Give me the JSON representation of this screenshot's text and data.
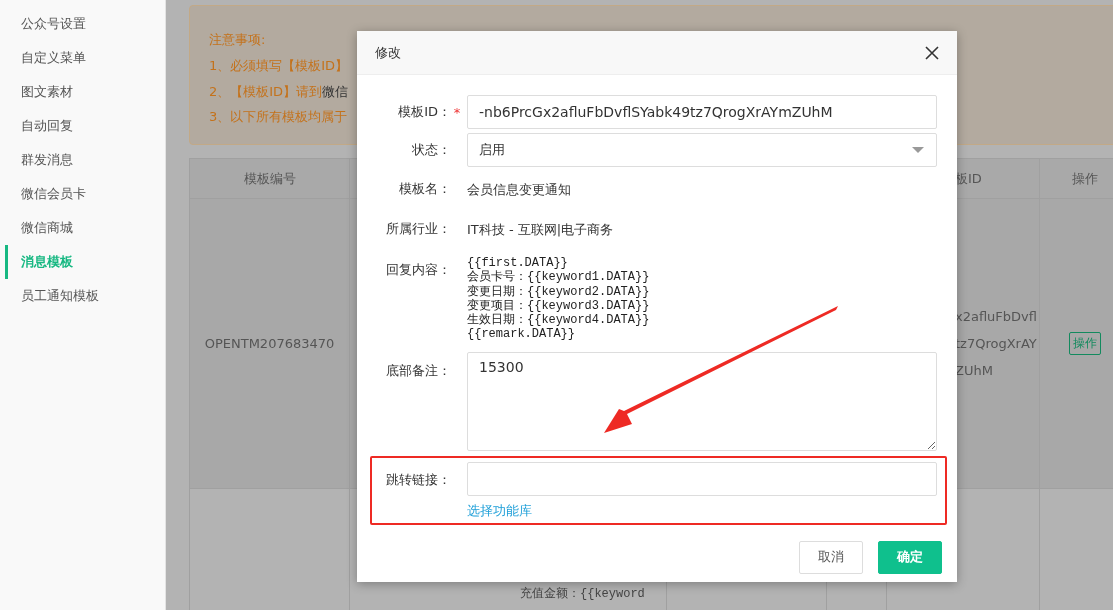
{
  "sidebar": {
    "items": [
      {
        "label": "公众号设置",
        "selected": false
      },
      {
        "label": "自定义菜单",
        "selected": false
      },
      {
        "label": "图文素材",
        "selected": false
      },
      {
        "label": "自动回复",
        "selected": false
      },
      {
        "label": "群发消息",
        "selected": false
      },
      {
        "label": "微信会员卡",
        "selected": false
      },
      {
        "label": "微信商城",
        "selected": false
      },
      {
        "label": "消息模板",
        "selected": true
      },
      {
        "label": "员工通知模板",
        "selected": false
      }
    ]
  },
  "notice": {
    "title": "注意事项:",
    "lines": [
      {
        "text": "1、必须填写【模板ID】"
      },
      {
        "text": "2、【模板ID】请到",
        "link": "微信"
      },
      {
        "text": "3、以下所有模板均属于"
      }
    ]
  },
  "table": {
    "columns": [
      "模板编号",
      "板ID",
      "操作"
    ],
    "rows": [
      {
        "template_no": "OPENTM207683470",
        "template_id": [
          "x2afluFbDvfl",
          "tz7QrogXrAY",
          "ZUhM"
        ],
        "action": "操作"
      },
      {
        "content": "充值金额：{{keyword"
      }
    ]
  },
  "dialog": {
    "title": "修改",
    "required_mark": "*",
    "fields": [
      {
        "kind": "input",
        "label": "模板ID：",
        "required": true,
        "highlighted": false,
        "value": "-nb6PrcGx2afluFbDvflSYabk49tz7QrogXrAYmZUhM"
      },
      {
        "kind": "select",
        "label": "状态：",
        "highlighted": false,
        "value": "启用"
      },
      {
        "kind": "text",
        "label": "模板名：",
        "highlighted": false,
        "value": "会员信息变更通知"
      },
      {
        "kind": "text",
        "label": "所属行业：",
        "highlighted": false,
        "value": "IT科技 - 互联网|电子商务"
      },
      {
        "kind": "lines",
        "label": "回复内容：",
        "highlighted": false,
        "lines": [
          "{{first.DATA}}",
          "会员卡号：{{keyword1.DATA}}",
          "变更日期：{{keyword2.DATA}}",
          "变更项目：{{keyword3.DATA}}",
          "生效日期：{{keyword4.DATA}}",
          "{{remark.DATA}}"
        ]
      },
      {
        "kind": "textarea",
        "label": "底部备注：",
        "highlighted": false,
        "value": "15300"
      },
      {
        "kind": "input",
        "label": "跳转链接：",
        "required": false,
        "highlighted": true,
        "link": "选择功能库"
      }
    ],
    "buttons": [
      {
        "label": "取消",
        "kind": "secondary"
      },
      {
        "label": "确定",
        "kind": "primary"
      }
    ]
  }
}
